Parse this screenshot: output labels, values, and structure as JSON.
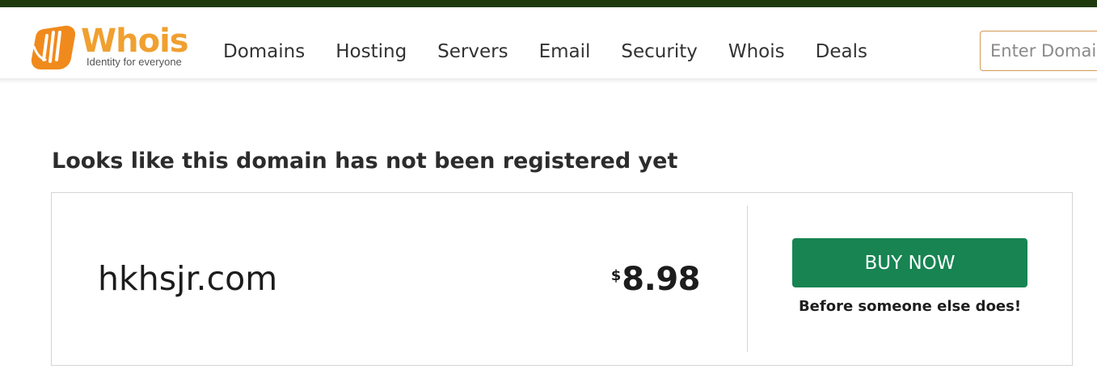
{
  "brand": {
    "name": "Whois",
    "tagline": "Identity for everyone",
    "logo_color": "#f0a030"
  },
  "nav": {
    "items": [
      {
        "label": "Domains"
      },
      {
        "label": "Hosting"
      },
      {
        "label": "Servers"
      },
      {
        "label": "Email"
      },
      {
        "label": "Security"
      },
      {
        "label": "Whois"
      },
      {
        "label": "Deals"
      }
    ]
  },
  "search": {
    "placeholder": "Enter Domain"
  },
  "result": {
    "headline": "Looks like this domain has not been registered yet",
    "domain": "hkhsjr.com",
    "currency": "$",
    "price": "8.98",
    "buy_label": "BUY NOW",
    "buy_subtext": "Before someone else does!",
    "buy_color": "#178452"
  },
  "icons": {
    "logo": "whois-hand-logo-icon"
  }
}
